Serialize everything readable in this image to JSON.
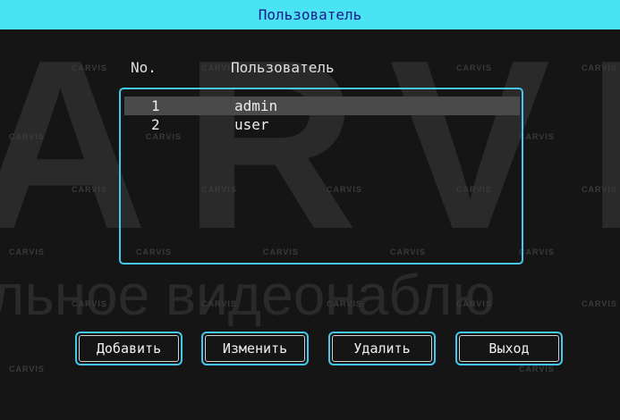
{
  "title": "Пользователь",
  "watermark": {
    "big": "ARVIS",
    "sub": "льное видеонаблю",
    "logo": "CARVIS"
  },
  "columns": {
    "no": "No.",
    "user": "Пользователь"
  },
  "users": [
    {
      "no": "1",
      "name": "admin",
      "selected": true
    },
    {
      "no": "2",
      "name": "user",
      "selected": false
    }
  ],
  "buttons": {
    "add": "Добавить",
    "edit": "Изменить",
    "delete": "Удалить",
    "exit": "Выход"
  },
  "colors": {
    "titlebar": "#49e3f4",
    "title_text": "#1a1a8a",
    "accent": "#43c8ee",
    "selection": "#4a4a4a"
  }
}
